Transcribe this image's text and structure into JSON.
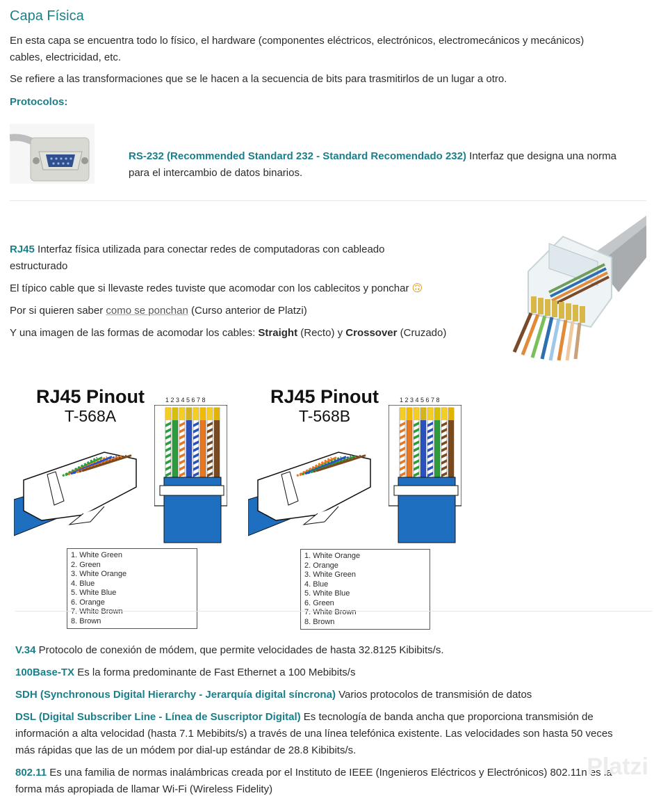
{
  "header": {
    "title": "Capa Física"
  },
  "intro": {
    "p1": "En esta capa se encuentra todo lo físico, el hardware (componentes eléctricos, electrónicos, electromecánicos y mecánicos)",
    "p1b": "cables, electricidad, etc.",
    "p2": "Se refiere a las transformaciones que se le hacen a la secuencia de bits para trasmitirlos de un lugar a otro.",
    "protocols_label": "Protocolos:"
  },
  "rs232": {
    "name": "RS-232 (Recommended Standard 232 - Standard Recomendado 232)",
    "desc1": " Interfaz que designa una norma",
    "desc2": "para el intercambio de datos binarios."
  },
  "rj45": {
    "name": "RJ45",
    "desc1": " Interfaz física utilizada para conectar redes de computadoras con cableado",
    "desc2": "estructurado",
    "line2": "El típico cable que si llevaste redes tuviste que acomodar con los cablecitos y ponchar",
    "emoji": "🙃",
    "line3_pre": "Por si quieren saber ",
    "line3_link": "como se ponchan",
    "line3_post": " (Curso anterior de Platzi)",
    "line4_pre": "Y una imagen de las formas de acomodar los cables: ",
    "straight": "Straight",
    "straight_es": " (Recto) y ",
    "crossover": "Crossover",
    "crossover_es": " (Cruzado)"
  },
  "pinout_a": {
    "title": "RJ45 Pinout",
    "subtitle": "T-568A",
    "numbers": "1 2 3 4 5 6 7 8",
    "legend_left": [
      "1. White Green",
      "2. Green",
      "3. White Orange",
      "4. Blue"
    ],
    "legend_right": [
      "5. White Blue",
      "6. Orange",
      "7. White Brown",
      "8. Brown"
    ],
    "wire_colors": [
      "#2e9b3d",
      "#2e9b3d",
      "#e87722",
      "#2a52be",
      "#2a52be",
      "#e87722",
      "#7a4a1e",
      "#7a4a1e"
    ],
    "striped": [
      true,
      false,
      true,
      false,
      true,
      false,
      true,
      false
    ]
  },
  "pinout_b": {
    "title": "RJ45 Pinout",
    "subtitle": "T-568B",
    "numbers": "1 2 3 4 5 6 7 8",
    "legend_left": [
      "1. White Orange",
      "2. Orange",
      "3. White Green",
      "4. Blue"
    ],
    "legend_right": [
      "5. White Blue",
      "6. Green",
      "7. White Brown",
      "8. Brown"
    ],
    "wire_colors": [
      "#e87722",
      "#e87722",
      "#2e9b3d",
      "#2a52be",
      "#2a52be",
      "#2e9b3d",
      "#7a4a1e",
      "#7a4a1e"
    ],
    "striped": [
      true,
      false,
      true,
      false,
      true,
      false,
      true,
      false
    ]
  },
  "protocols": [
    {
      "name": "V.34",
      "desc": " Protocolo de conexión de módem, que permite velocidades de hasta 32.8125 Kibibits/s."
    },
    {
      "name": "100Base-TX",
      "desc": " Es la forma predominante de Fast Ethernet a 100 Mebibits/s"
    },
    {
      "name": "SDH (Synchronous Digital Hierarchy - Jerarquía digital síncrona)",
      "desc": " Varios protocolos de transmisión de datos"
    }
  ],
  "dsl": {
    "name": "DSL (Digital Subscriber Line - Línea de Suscriptor Digital)",
    "desc1": " Es tecnología de banda ancha que proporciona transmisión de",
    "desc2": "información a alta velocidad (hasta 7.1 Mebibits/s) a través de una línea telefónica existente. Las velocidades son hasta 50 veces",
    "desc3": "más rápidas que las de un módem por dial-up estándar de 28.8 Kibibits/s."
  },
  "wifi": {
    "name": "802.11",
    "desc1": " Es una familia de normas inalámbricas creada por el Instituto de  IEEE (Ingenieros Eléctricos y Electrónicos) 802.11n es la",
    "desc2": "forma más apropiada de llamar Wi-Fi (Wireless Fidelity)"
  },
  "watermark": "Platzi",
  "colors": {
    "accent": "#1b7f8a",
    "cable_blue": "#1e6fc0"
  }
}
